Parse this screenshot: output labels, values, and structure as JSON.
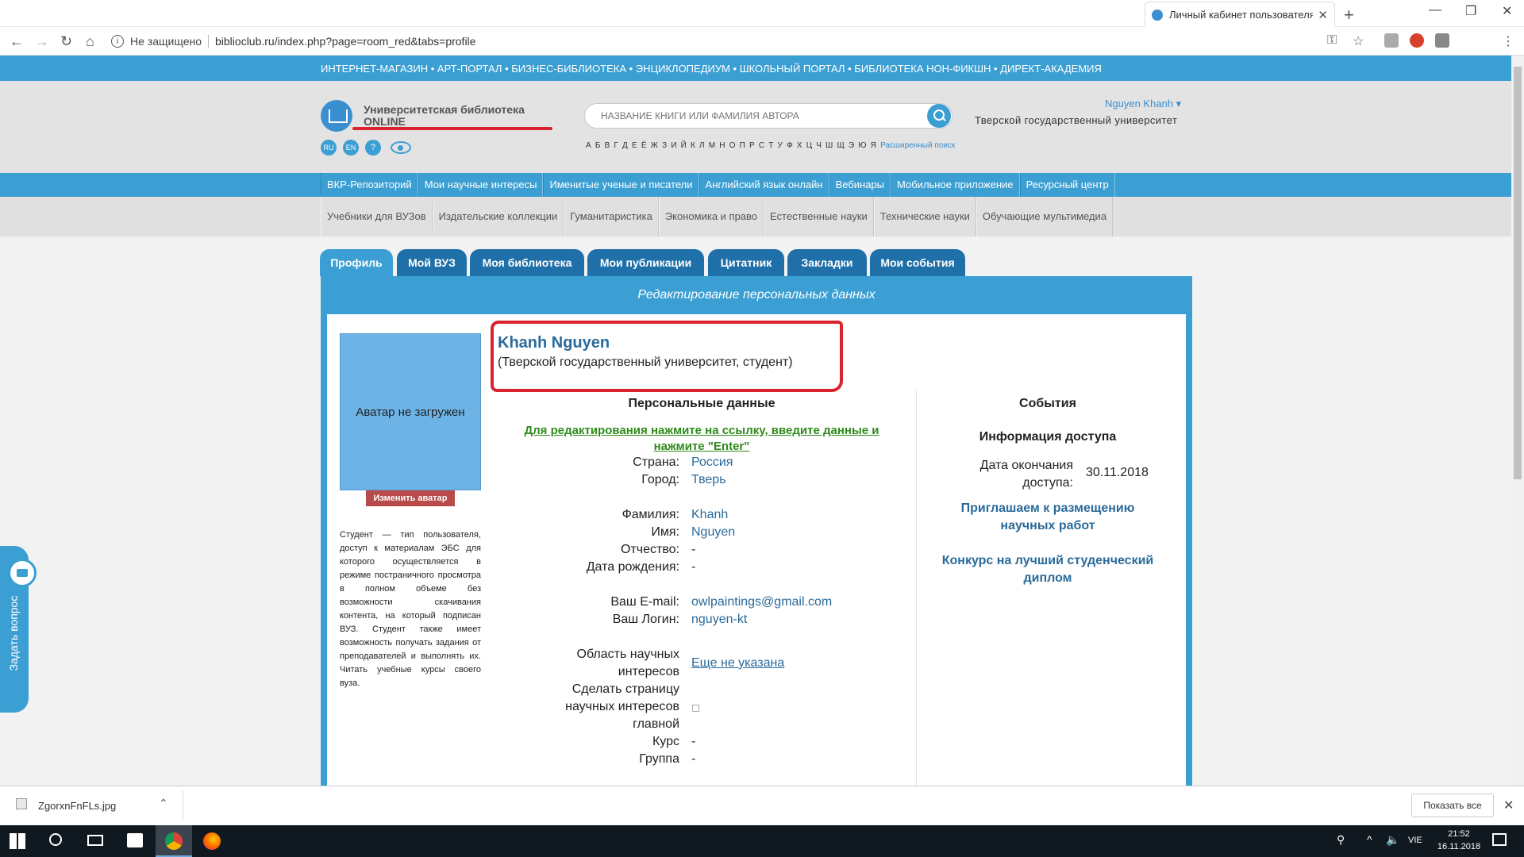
{
  "browser": {
    "tab_title": "Личный кабинет пользователя",
    "not_secure": "Не защищено",
    "url": "biblioclub.ru/index.php?page=room_red&tabs=profile"
  },
  "site": {
    "top_links": "ИНТЕРНЕТ-МАГАЗИН • АРТ-ПОРТАЛ • БИЗНЕС-БИБЛИОТЕКА • ЭНЦИКЛОПЕДИУМ • ШКОЛЬНЫЙ ПОРТАЛ • БИБЛИОТЕКА НОН-ФИКШН • ДИРЕКТ-АКАДЕМИЯ",
    "logo_line1": "Университетская библиотека",
    "logo_line2": "ONLINE",
    "lang_ru": "RU",
    "lang_en": "EN",
    "help": "?",
    "search_placeholder": "НАЗВАНИЕ КНИГИ ИЛИ ФАМИЛИЯ АВТОРА",
    "alphabet": "А Б В Г Д Е Ё Ж З И Й К Л М Н О П Р С Т У Ф Х Ц Ч Ш Щ Э Ю Я",
    "advanced_search": "Расширенный поиск",
    "user_name": "Nguyen Khanh ▾",
    "university": "Тверской государственный университет"
  },
  "menu1": [
    "ВКР-Репозиторий",
    "Мои научные интересы",
    "Именитые ученые и писатели",
    "Английский язык онлайн",
    "Вебинары",
    "Мобильное приложение",
    "Ресурсный центр"
  ],
  "menu2": [
    "Учебники для ВУЗов",
    "Издательские коллекции",
    "Гуманитаристика",
    "Экономика и право",
    "Естественные науки",
    "Технические науки",
    "Обучающие мультимедиа"
  ],
  "tabs": [
    "Профиль",
    "Мой ВУЗ",
    "Моя библиотека",
    "Мои публикации",
    "Цитатник",
    "Закладки",
    "Мои события"
  ],
  "panel": {
    "heading": "Редактирование персональных данных",
    "avatar_text": "Аватар не загружен",
    "change_avatar": "Изменить аватар",
    "role_description": "Студент — тип пользователя, доступ к материалам ЭБС для которого осуществляется в режиме постраничного просмотра в полном объеме без возможности скачивания контента, на который подписан ВУЗ. Студент также имеет возможность получать задания от преподавателей и выполнять их. Читать учебные курсы своего вуза.",
    "full_name": "Khanh Nguyen",
    "affiliation": "(Тверской государственный университет, студент)",
    "personal_title": "Персональные данные",
    "edit_hint": "Для редактирования нажмите на ссылку, введите данные и нажмите \"Enter\"",
    "country_label": "Страна:",
    "country": "Россия",
    "city_label": "Город:",
    "city": "Тверь",
    "surname_label": "Фамилия:",
    "surname": "Khanh",
    "first_name_label": "Имя:",
    "first_name": "Nguyen",
    "patronymic_label": "Отчество:",
    "patronymic": "-",
    "birth_label": "Дата рождения:",
    "birth": "-",
    "email_label": "Ваш E-mail:",
    "email": "owlpaintings@gmail.com",
    "login_label": "Ваш Логин:",
    "login": "nguyen-kt",
    "interests_label": "Область научных интересов",
    "interests": "Еще не указана",
    "make_main_label": "Сделать страницу научных интересов главной",
    "course_label": "Курс",
    "course": "-",
    "group_label": "Группа",
    "group": "-",
    "events_title": "События",
    "access_title": "Информация доступа",
    "access_end_label": "Дата окончания доступа:",
    "access_end": "30.11.2018",
    "invite_link": "Приглашаем к размещению научных работ",
    "contest_link": "Конкурс на лучший студенческий диплом"
  },
  "ask_question": "Задать вопрос",
  "downloads": {
    "file": "ZgorxnFnFLs.jpg",
    "show_all": "Показать все"
  },
  "taskbar": {
    "lang": "VIE",
    "time": "21:52",
    "date": "16.11.2018"
  }
}
